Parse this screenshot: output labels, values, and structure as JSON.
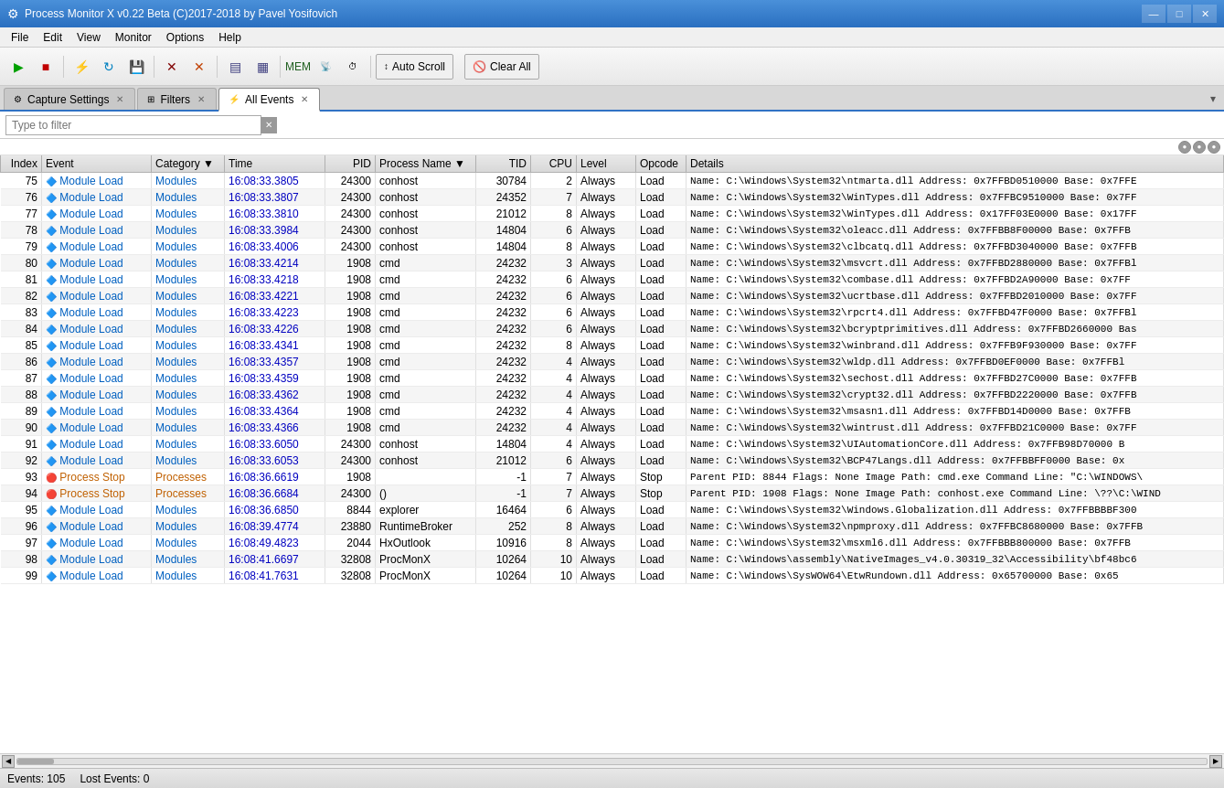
{
  "app": {
    "title": "Process Monitor X v0.22 Beta (C)2017-2018 by Pavel Yosifovich",
    "icon": "⚙"
  },
  "window_controls": {
    "minimize": "—",
    "maximize": "□",
    "close": "✕"
  },
  "menu": {
    "items": [
      "File",
      "Edit",
      "View",
      "Monitor",
      "Options",
      "Help"
    ]
  },
  "toolbar": {
    "auto_scroll_label": "Auto Scroll",
    "clear_all_label": "Clear All"
  },
  "tabs": {
    "capture_settings": "Capture Settings",
    "filters": "Filters",
    "all_events": "All Events",
    "dropdown_arrow": "▾"
  },
  "filter": {
    "placeholder": "Type to filter"
  },
  "table": {
    "columns": [
      "Index",
      "Event",
      "Category",
      "Time",
      "PID",
      "Process Name",
      "TID",
      "CPU",
      "Level",
      "Opcode",
      "Details"
    ],
    "rows": [
      {
        "index": 75,
        "event": "Module Load",
        "category": "Modules",
        "time": "16:08:33.3805",
        "pid": 24300,
        "process": "conhost",
        "tid": 30784,
        "cpu": 2,
        "level": "Always",
        "opcode": "Load",
        "details": "Name: C:\\Windows\\System32\\ntmarta.dll Address: 0x7FFBD0510000 Base: 0x7FFE",
        "row_type": "module"
      },
      {
        "index": 76,
        "event": "Module Load",
        "category": "Modules",
        "time": "16:08:33.3807",
        "pid": 24300,
        "process": "conhost",
        "tid": 24352,
        "cpu": 7,
        "level": "Always",
        "opcode": "Load",
        "details": "Name: C:\\Windows\\System32\\WinTypes.dll Address: 0x7FFBC9510000 Base: 0x7FF",
        "row_type": "module"
      },
      {
        "index": 77,
        "event": "Module Load",
        "category": "Modules",
        "time": "16:08:33.3810",
        "pid": 24300,
        "process": "conhost",
        "tid": 21012,
        "cpu": 8,
        "level": "Always",
        "opcode": "Load",
        "details": "Name: C:\\Windows\\System32\\WinTypes.dll Address: 0x17FF03E0000 Base: 0x17FF",
        "row_type": "module"
      },
      {
        "index": 78,
        "event": "Module Load",
        "category": "Modules",
        "time": "16:08:33.3984",
        "pid": 24300,
        "process": "conhost",
        "tid": 14804,
        "cpu": 6,
        "level": "Always",
        "opcode": "Load",
        "details": "Name: C:\\Windows\\System32\\oleacc.dll Address: 0x7FFBB8F00000 Base: 0x7FFB",
        "row_type": "module"
      },
      {
        "index": 79,
        "event": "Module Load",
        "category": "Modules",
        "time": "16:08:33.4006",
        "pid": 24300,
        "process": "conhost",
        "tid": 14804,
        "cpu": 8,
        "level": "Always",
        "opcode": "Load",
        "details": "Name: C:\\Windows\\System32\\clbcatq.dll Address: 0x7FFBD3040000 Base: 0x7FFB",
        "row_type": "module"
      },
      {
        "index": 80,
        "event": "Module Load",
        "category": "Modules",
        "time": "16:08:33.4214",
        "pid": 1908,
        "process": "cmd",
        "tid": 24232,
        "cpu": 3,
        "level": "Always",
        "opcode": "Load",
        "details": "Name: C:\\Windows\\System32\\msvcrt.dll Address: 0x7FFBD2880000 Base: 0x7FFBl",
        "row_type": "module"
      },
      {
        "index": 81,
        "event": "Module Load",
        "category": "Modules",
        "time": "16:08:33.4218",
        "pid": 1908,
        "process": "cmd",
        "tid": 24232,
        "cpu": 6,
        "level": "Always",
        "opcode": "Load",
        "details": "Name: C:\\Windows\\System32\\combase.dll Address: 0x7FFBD2A90000 Base: 0x7FF",
        "row_type": "module"
      },
      {
        "index": 82,
        "event": "Module Load",
        "category": "Modules",
        "time": "16:08:33.4221",
        "pid": 1908,
        "process": "cmd",
        "tid": 24232,
        "cpu": 6,
        "level": "Always",
        "opcode": "Load",
        "details": "Name: C:\\Windows\\System32\\ucrtbase.dll Address: 0x7FFBD2010000 Base: 0x7FF",
        "row_type": "module"
      },
      {
        "index": 83,
        "event": "Module Load",
        "category": "Modules",
        "time": "16:08:33.4223",
        "pid": 1908,
        "process": "cmd",
        "tid": 24232,
        "cpu": 6,
        "level": "Always",
        "opcode": "Load",
        "details": "Name: C:\\Windows\\System32\\rpcrt4.dll Address: 0x7FFBD47F0000 Base: 0x7FFBl",
        "row_type": "module"
      },
      {
        "index": 84,
        "event": "Module Load",
        "category": "Modules",
        "time": "16:08:33.4226",
        "pid": 1908,
        "process": "cmd",
        "tid": 24232,
        "cpu": 6,
        "level": "Always",
        "opcode": "Load",
        "details": "Name: C:\\Windows\\System32\\bcryptprimitives.dll Address: 0x7FFBD2660000 Bas",
        "row_type": "module"
      },
      {
        "index": 85,
        "event": "Module Load",
        "category": "Modules",
        "time": "16:08:33.4341",
        "pid": 1908,
        "process": "cmd",
        "tid": 24232,
        "cpu": 8,
        "level": "Always",
        "opcode": "Load",
        "details": "Name: C:\\Windows\\System32\\winbrand.dll Address: 0x7FFB9F930000 Base: 0x7FF",
        "row_type": "module"
      },
      {
        "index": 86,
        "event": "Module Load",
        "category": "Modules",
        "time": "16:08:33.4357",
        "pid": 1908,
        "process": "cmd",
        "tid": 24232,
        "cpu": 4,
        "level": "Always",
        "opcode": "Load",
        "details": "Name: C:\\Windows\\System32\\wldp.dll Address: 0x7FFBD0EF0000 Base: 0x7FFBl",
        "row_type": "module"
      },
      {
        "index": 87,
        "event": "Module Load",
        "category": "Modules",
        "time": "16:08:33.4359",
        "pid": 1908,
        "process": "cmd",
        "tid": 24232,
        "cpu": 4,
        "level": "Always",
        "opcode": "Load",
        "details": "Name: C:\\Windows\\System32\\sechost.dll Address: 0x7FFBD27C0000 Base: 0x7FFB",
        "row_type": "module"
      },
      {
        "index": 88,
        "event": "Module Load",
        "category": "Modules",
        "time": "16:08:33.4362",
        "pid": 1908,
        "process": "cmd",
        "tid": 24232,
        "cpu": 4,
        "level": "Always",
        "opcode": "Load",
        "details": "Name: C:\\Windows\\System32\\crypt32.dll Address: 0x7FFBD2220000 Base: 0x7FFB",
        "row_type": "module"
      },
      {
        "index": 89,
        "event": "Module Load",
        "category": "Modules",
        "time": "16:08:33.4364",
        "pid": 1908,
        "process": "cmd",
        "tid": 24232,
        "cpu": 4,
        "level": "Always",
        "opcode": "Load",
        "details": "Name: C:\\Windows\\System32\\msasn1.dll Address: 0x7FFBD14D0000 Base: 0x7FFB",
        "row_type": "module"
      },
      {
        "index": 90,
        "event": "Module Load",
        "category": "Modules",
        "time": "16:08:33.4366",
        "pid": 1908,
        "process": "cmd",
        "tid": 24232,
        "cpu": 4,
        "level": "Always",
        "opcode": "Load",
        "details": "Name: C:\\Windows\\System32\\wintrust.dll Address: 0x7FFBD21C0000 Base: 0x7FF",
        "row_type": "module"
      },
      {
        "index": 91,
        "event": "Module Load",
        "category": "Modules",
        "time": "16:08:33.6050",
        "pid": 24300,
        "process": "conhost",
        "tid": 14804,
        "cpu": 4,
        "level": "Always",
        "opcode": "Load",
        "details": "Name: C:\\Windows\\System32\\UIAutomationCore.dll Address: 0x7FFB98D70000 B",
        "row_type": "module"
      },
      {
        "index": 92,
        "event": "Module Load",
        "category": "Modules",
        "time": "16:08:33.6053",
        "pid": 24300,
        "process": "conhost",
        "tid": 21012,
        "cpu": 6,
        "level": "Always",
        "opcode": "Load",
        "details": "Name: C:\\Windows\\System32\\BCP47Langs.dll Address: 0x7FFBBFF0000 Base: 0x",
        "row_type": "module"
      },
      {
        "index": 93,
        "event": "Process Stop",
        "category": "Processes",
        "time": "16:08:36.6619",
        "pid": 1908,
        "process": "",
        "tid": -1,
        "cpu": 7,
        "level": "Always",
        "opcode": "Stop",
        "details": "Parent PID: 8844 Flags: None Image Path: cmd.exe Command Line: \"C:\\WINDOWS\\",
        "row_type": "process_stop"
      },
      {
        "index": 94,
        "event": "Process Stop",
        "category": "Processes",
        "time": "16:08:36.6684",
        "pid": 24300,
        "process": "()",
        "tid": -1,
        "cpu": 7,
        "level": "Always",
        "opcode": "Stop",
        "details": "Parent PID: 1908 Flags: None Image Path: conhost.exe Command Line: \\??\\C:\\WIND",
        "row_type": "process_stop"
      },
      {
        "index": 95,
        "event": "Module Load",
        "category": "Modules",
        "time": "16:08:36.6850",
        "pid": 8844,
        "process": "explorer",
        "tid": 16464,
        "cpu": 6,
        "level": "Always",
        "opcode": "Load",
        "details": "Name: C:\\Windows\\System32\\Windows.Globalization.dll Address: 0x7FFBBBBF300",
        "row_type": "module"
      },
      {
        "index": 96,
        "event": "Module Load",
        "category": "Modules",
        "time": "16:08:39.4774",
        "pid": 23880,
        "process": "RuntimeBroker",
        "tid": 252,
        "cpu": 8,
        "level": "Always",
        "opcode": "Load",
        "details": "Name: C:\\Windows\\System32\\npmproxy.dll Address: 0x7FFBC8680000 Base: 0x7FFB",
        "row_type": "module"
      },
      {
        "index": 97,
        "event": "Module Load",
        "category": "Modules",
        "time": "16:08:49.4823",
        "pid": 2044,
        "process": "HxOutlook",
        "tid": 10916,
        "cpu": 8,
        "level": "Always",
        "opcode": "Load",
        "details": "Name: C:\\Windows\\System32\\msxml6.dll Address: 0x7FFBBB800000 Base: 0x7FFB",
        "row_type": "module"
      },
      {
        "index": 98,
        "event": "Module Load",
        "category": "Modules",
        "time": "16:08:41.6697",
        "pid": 32808,
        "process": "ProcMonX",
        "tid": 10264,
        "cpu": 10,
        "level": "Always",
        "opcode": "Load",
        "details": "Name: C:\\Windows\\assembly\\NativeImages_v4.0.30319_32\\Accessibility\\bf48bc6",
        "row_type": "module"
      },
      {
        "index": 99,
        "event": "Module Load",
        "category": "Modules",
        "time": "16:08:41.7631",
        "pid": 32808,
        "process": "ProcMonX",
        "tid": 10264,
        "cpu": 10,
        "level": "Always",
        "opcode": "Load",
        "details": "Name: C:\\Windows\\SysWOW64\\EtwRundown.dll Address: 0x65700000 Base: 0x65",
        "row_type": "module"
      }
    ]
  },
  "status_bar": {
    "events_label": "Events: 105",
    "lost_events_label": "Lost Events: 0"
  }
}
